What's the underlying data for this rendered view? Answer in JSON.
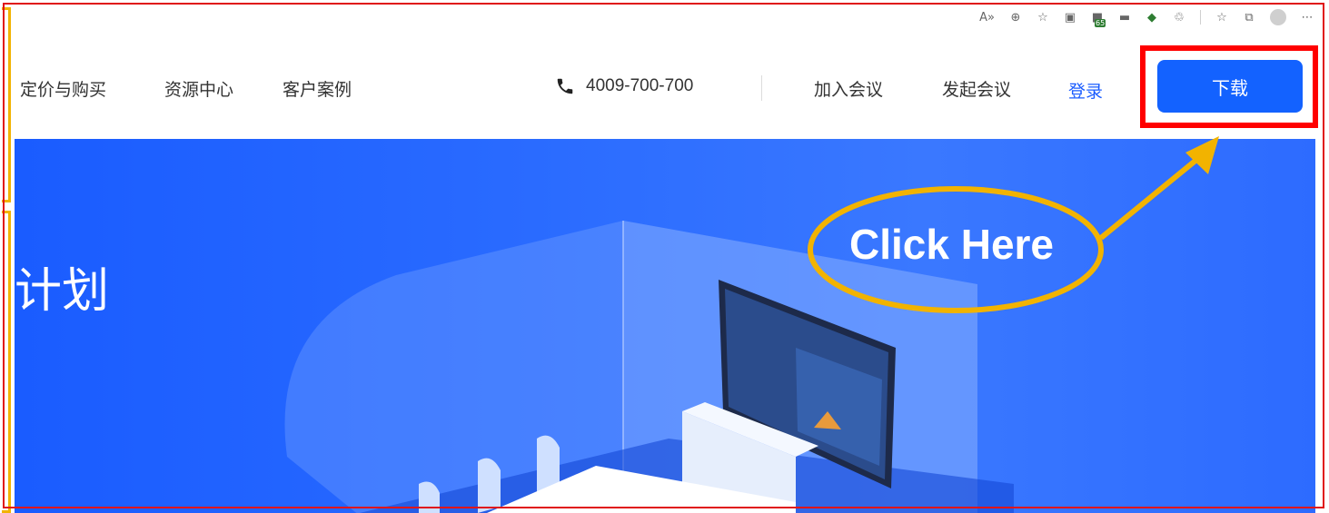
{
  "browser_toolbar": {
    "icons": [
      "read-aloud-icon",
      "zoom-icon",
      "favorite-icon",
      "collections-icon",
      "extension-icon",
      "extension-icon",
      "extension-icon",
      "extension-icon",
      "favorites-list-icon",
      "profile-icon",
      "more-icon"
    ],
    "badge": "65"
  },
  "nav": {
    "items": [
      "定价与购买",
      "资源中心",
      "客户案例"
    ],
    "phone": "4009-700-700",
    "join_meeting": "加入会议",
    "start_meeting": "发起会议",
    "login": "登录",
    "download": "下载"
  },
  "hero": {
    "title_fragment": "计划"
  },
  "annotation": {
    "text": "Click Here",
    "color": "#f2b300",
    "highlight_color": "#ff0000"
  },
  "colors": {
    "brand_blue": "#1362ff",
    "hero_blue": "#2a6bff"
  }
}
